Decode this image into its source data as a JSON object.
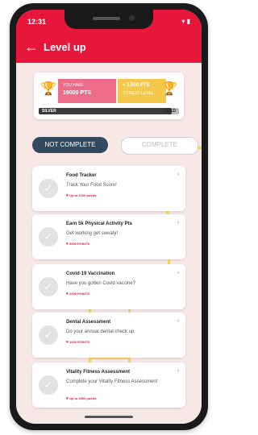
{
  "status": {
    "time": "12:31",
    "icons": "▾ ▮"
  },
  "app": {
    "title": "Level up",
    "back_icon": "←"
  },
  "points": {
    "have_label": "YOU HAVE",
    "have_value": "19000 PTS",
    "next_value": "+ 1,000 PTS",
    "next_label": "TO NEXT LEVEL",
    "level_current": "SILVER",
    "level_next": "GOLD",
    "progress": 0.95
  },
  "tabs": {
    "not_complete": "NOT COMPLETE",
    "complete": "COMPLETE"
  },
  "tasks": [
    {
      "title": "Food Tracker",
      "subtitle": "Track Your Food Score!",
      "points": "Up to 1200 points"
    },
    {
      "title": "Earn 5k Physical Activity Pts",
      "subtitle": "Get working get sweaty!",
      "points": "5000 POINTS"
    },
    {
      "title": "Covid-19 Vaccination",
      "subtitle": "Have you gotten Covid vaccine?",
      "points": "2000 POINTS"
    },
    {
      "title": "Dental Assessment",
      "subtitle": "Do your annual dental check up",
      "points": "1000 POINTS"
    },
    {
      "title": "Vitality Fitness Assessment",
      "subtitle": "Complete your Vitality Fitness Assessment",
      "points": "Up to 3000 points"
    }
  ],
  "colors": {
    "brand": "#e8163b",
    "pink": "#ee6b8a",
    "gold": "#f4c84a",
    "tab_active": "#34495e"
  }
}
